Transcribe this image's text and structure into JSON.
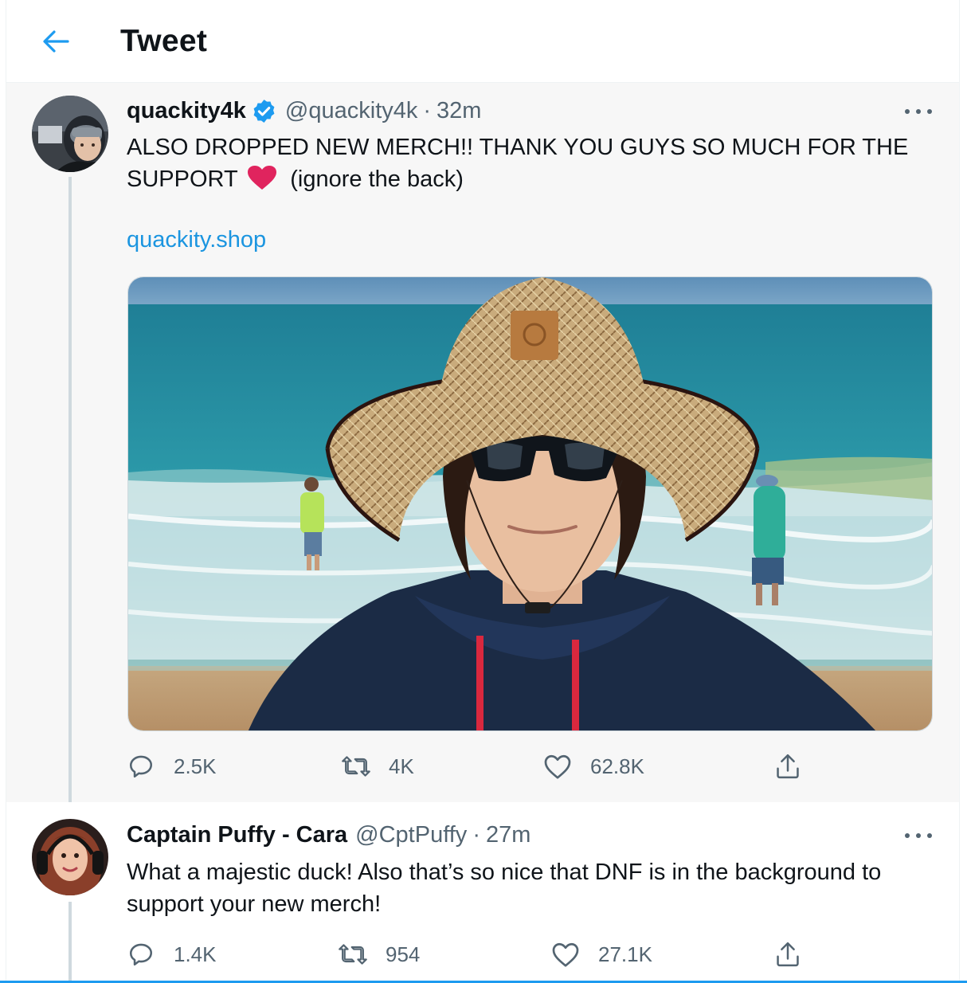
{
  "header": {
    "title": "Tweet"
  },
  "tweets": [
    {
      "display_name": "quackity4k",
      "handle": "@quackity4k",
      "separator": "·",
      "time": "32m",
      "text_line1": "ALSO DROPPED NEW MERCH!! THANK YOU GUYS SO MUCH FOR THE",
      "text_line2_a": "SUPPORT",
      "text_line2_b": "(ignore the back)",
      "link": "quackity.shop",
      "stats": {
        "replies": "2.5K",
        "retweets": "4K",
        "likes": "62.8K"
      }
    },
    {
      "display_name": "Captain Puffy - Cara",
      "handle": "@CptPuffy",
      "separator": "·",
      "time": "27m",
      "text": "What a majestic duck! Also that’s so nice that DNF is in the background to support your new merch!",
      "stats": {
        "replies": "1.4K",
        "retweets": "954",
        "likes": "27.1K"
      }
    }
  ],
  "icons": {
    "back": "arrow-left-icon",
    "verified": "verified-badge-icon",
    "more": "more-dots-icon",
    "reply": "reply-bubble-icon",
    "retweet": "retweet-icon",
    "like": "heart-outline-icon",
    "share": "share-upload-icon",
    "emoji": "red-heart-emoji"
  },
  "colors": {
    "accent": "#1d9bf0",
    "link": "#1b95e0",
    "muted_text": "#536471",
    "heart_emoji": "#e0245e"
  }
}
